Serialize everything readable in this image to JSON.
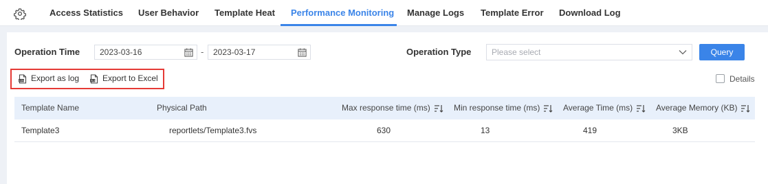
{
  "tabs": [
    {
      "label": "Access Statistics"
    },
    {
      "label": "User Behavior"
    },
    {
      "label": "Template Heat"
    },
    {
      "label": "Performance Monitoring",
      "active": true
    },
    {
      "label": "Manage Logs"
    },
    {
      "label": "Template Error"
    },
    {
      "label": "Download Log"
    }
  ],
  "filters": {
    "operation_time_label": "Operation Time",
    "start_date": "2023-03-16",
    "separator": "-",
    "end_date": "2023-03-17",
    "operation_type_label": "Operation Type",
    "operation_type_placeholder": "Please select",
    "query_label": "Query"
  },
  "toolbar": {
    "export_log_label": "Export as log",
    "export_excel_label": "Export to Excel",
    "details_label": "Details",
    "details_checked": false
  },
  "table": {
    "columns": [
      "Template Name",
      "Physical Path",
      "Max response time (ms)",
      "Min response time (ms)",
      "Average Time (ms)",
      "Average Memory (KB)"
    ],
    "rows": [
      [
        "Template3",
        "reportlets/Template3.fvs",
        "630",
        "13",
        "419",
        "3KB"
      ]
    ]
  },
  "colors": {
    "accent": "#3a84e8",
    "highlight_border": "#e53935",
    "header_bg": "#e8f0fb"
  }
}
